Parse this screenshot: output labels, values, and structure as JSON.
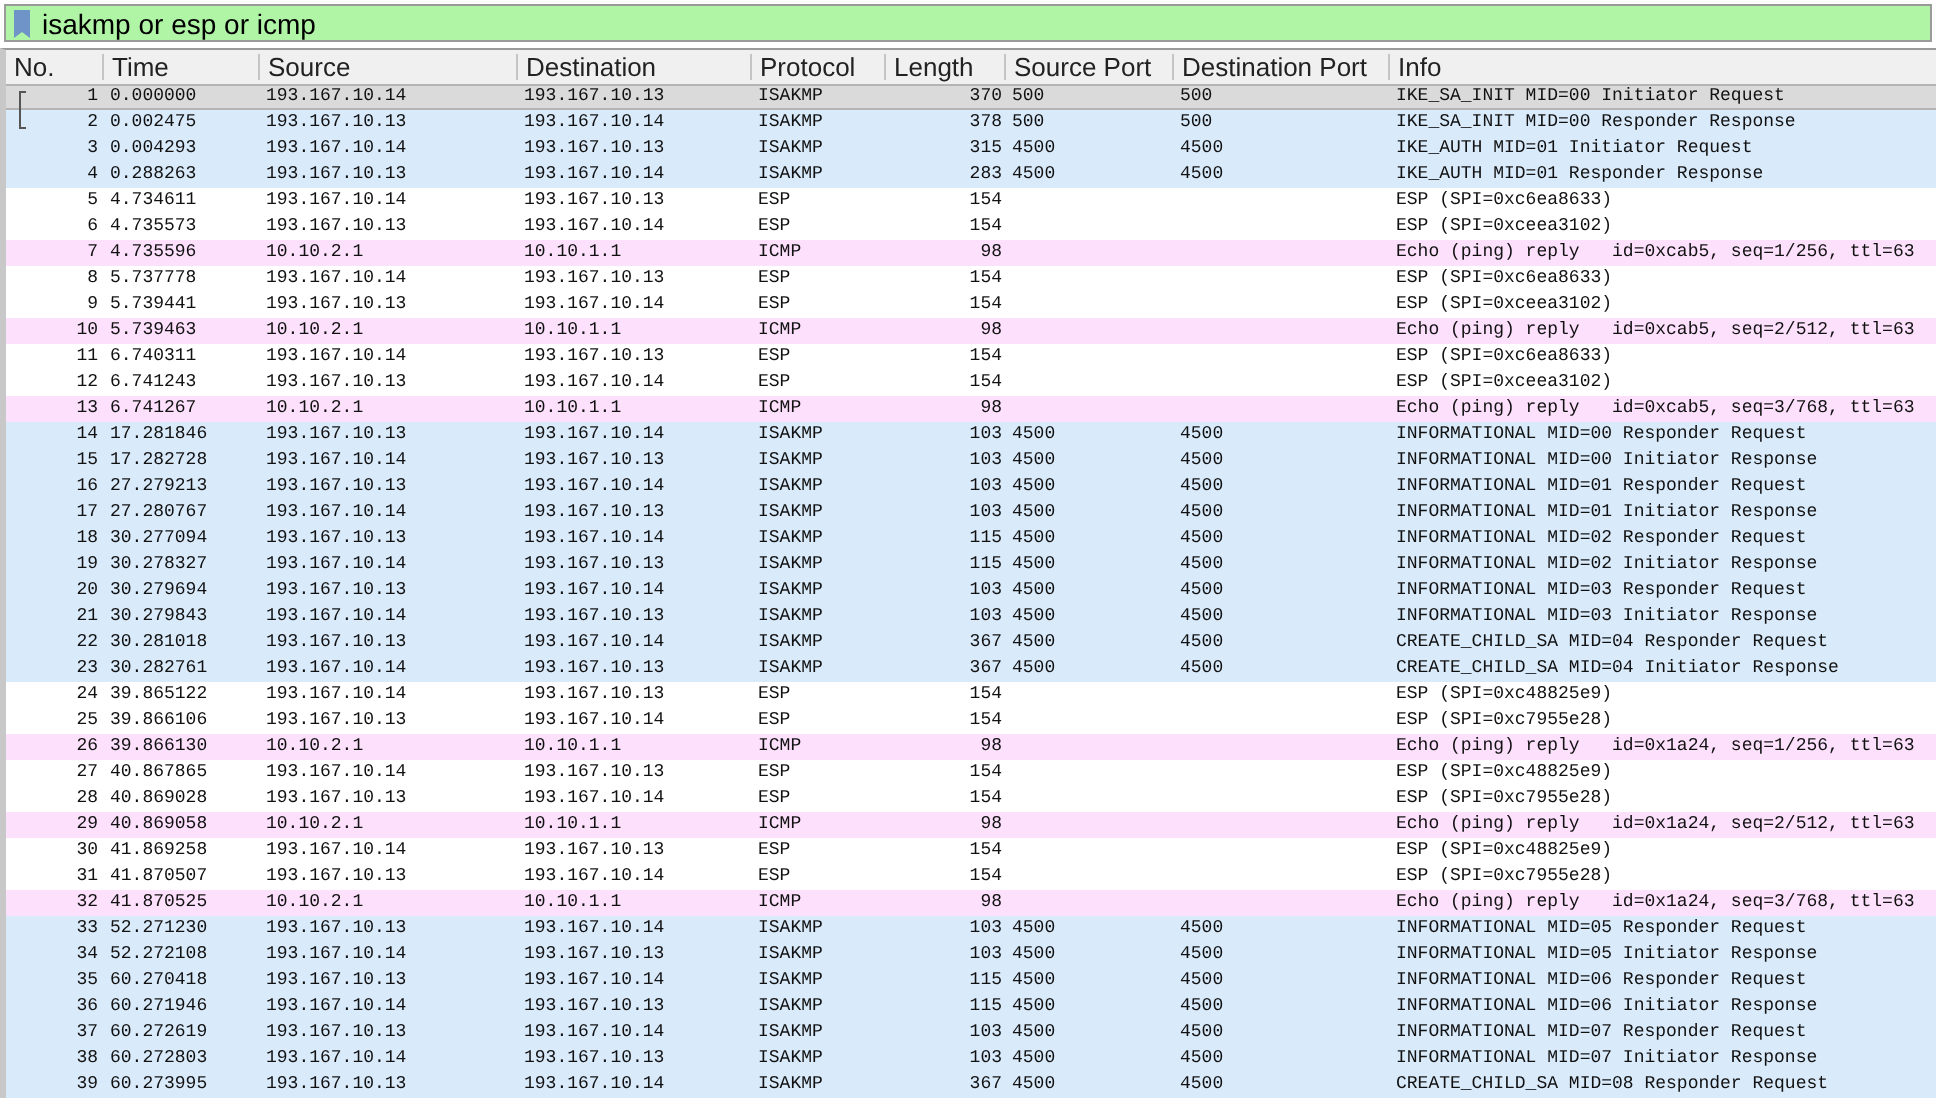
{
  "filter": {
    "value": "isakmp or esp or icmp"
  },
  "columns": [
    "No.",
    "Time",
    "Source",
    "Destination",
    "Protocol",
    "Length",
    "Source Port",
    "Destination Port",
    "Info"
  ],
  "rows": [
    {
      "no": "1",
      "time": "0.000000",
      "source": "193.167.10.14",
      "destination": "193.167.10.13",
      "protocol": "ISAKMP",
      "length": "370",
      "source_port": "500",
      "destination_port": "500",
      "info": "IKE_SA_INIT MID=00 Initiator Request",
      "color": "#dadada",
      "selected": true,
      "related": true
    },
    {
      "no": "2",
      "time": "0.002475",
      "source": "193.167.10.13",
      "destination": "193.167.10.14",
      "protocol": "ISAKMP",
      "length": "378",
      "source_port": "500",
      "destination_port": "500",
      "info": "IKE_SA_INIT MID=00 Responder Response",
      "color": "#d9eafb",
      "selected": false,
      "related": true
    },
    {
      "no": "3",
      "time": "0.004293",
      "source": "193.167.10.14",
      "destination": "193.167.10.13",
      "protocol": "ISAKMP",
      "length": "315",
      "source_port": "4500",
      "destination_port": "4500",
      "info": "IKE_AUTH MID=01 Initiator Request",
      "color": "#d9eafb",
      "selected": false,
      "related": false
    },
    {
      "no": "4",
      "time": "0.288263",
      "source": "193.167.10.13",
      "destination": "193.167.10.14",
      "protocol": "ISAKMP",
      "length": "283",
      "source_port": "4500",
      "destination_port": "4500",
      "info": "IKE_AUTH MID=01 Responder Response",
      "color": "#d9eafb",
      "selected": false,
      "related": false
    },
    {
      "no": "5",
      "time": "4.734611",
      "source": "193.167.10.14",
      "destination": "193.167.10.13",
      "protocol": "ESP",
      "length": "154",
      "info": "ESP (SPI=0xc6ea8633)",
      "color": "#ffffff",
      "selected": false,
      "related": false
    },
    {
      "no": "6",
      "time": "4.735573",
      "source": "193.167.10.13",
      "destination": "193.167.10.14",
      "protocol": "ESP",
      "length": "154",
      "info": "ESP (SPI=0xceea3102)",
      "color": "#ffffff",
      "selected": false,
      "related": false
    },
    {
      "no": "7",
      "time": "4.735596",
      "source": "10.10.2.1",
      "destination": "10.10.1.1",
      "protocol": "ICMP",
      "length": "98",
      "info": "Echo (ping) reply   id=0xcab5, seq=1/256, ttl=63",
      "color": "#fce0fc",
      "selected": false,
      "related": false
    },
    {
      "no": "8",
      "time": "5.737778",
      "source": "193.167.10.14",
      "destination": "193.167.10.13",
      "protocol": "ESP",
      "length": "154",
      "info": "ESP (SPI=0xc6ea8633)",
      "color": "#ffffff",
      "selected": false,
      "related": false
    },
    {
      "no": "9",
      "time": "5.739441",
      "source": "193.167.10.13",
      "destination": "193.167.10.14",
      "protocol": "ESP",
      "length": "154",
      "info": "ESP (SPI=0xceea3102)",
      "color": "#ffffff",
      "selected": false,
      "related": false
    },
    {
      "no": "10",
      "time": "5.739463",
      "source": "10.10.2.1",
      "destination": "10.10.1.1",
      "protocol": "ICMP",
      "length": "98",
      "info": "Echo (ping) reply   id=0xcab5, seq=2/512, ttl=63",
      "color": "#fce0fc",
      "selected": false,
      "related": false
    },
    {
      "no": "11",
      "time": "6.740311",
      "source": "193.167.10.14",
      "destination": "193.167.10.13",
      "protocol": "ESP",
      "length": "154",
      "info": "ESP (SPI=0xc6ea8633)",
      "color": "#ffffff",
      "selected": false,
      "related": false
    },
    {
      "no": "12",
      "time": "6.741243",
      "source": "193.167.10.13",
      "destination": "193.167.10.14",
      "protocol": "ESP",
      "length": "154",
      "info": "ESP (SPI=0xceea3102)",
      "color": "#ffffff",
      "selected": false,
      "related": false
    },
    {
      "no": "13",
      "time": "6.741267",
      "source": "10.10.2.1",
      "destination": "10.10.1.1",
      "protocol": "ICMP",
      "length": "98",
      "info": "Echo (ping) reply   id=0xcab5, seq=3/768, ttl=63",
      "color": "#fce0fc",
      "selected": false,
      "related": false
    },
    {
      "no": "14",
      "time": "17.281846",
      "source": "193.167.10.13",
      "destination": "193.167.10.14",
      "protocol": "ISAKMP",
      "length": "103",
      "source_port": "4500",
      "destination_port": "4500",
      "info": "INFORMATIONAL MID=00 Responder Request",
      "color": "#d9eafb",
      "selected": false,
      "related": false
    },
    {
      "no": "15",
      "time": "17.282728",
      "source": "193.167.10.14",
      "destination": "193.167.10.13",
      "protocol": "ISAKMP",
      "length": "103",
      "source_port": "4500",
      "destination_port": "4500",
      "info": "INFORMATIONAL MID=00 Initiator Response",
      "color": "#d9eafb",
      "selected": false,
      "related": false
    },
    {
      "no": "16",
      "time": "27.279213",
      "source": "193.167.10.13",
      "destination": "193.167.10.14",
      "protocol": "ISAKMP",
      "length": "103",
      "source_port": "4500",
      "destination_port": "4500",
      "info": "INFORMATIONAL MID=01 Responder Request",
      "color": "#d9eafb",
      "selected": false,
      "related": false
    },
    {
      "no": "17",
      "time": "27.280767",
      "source": "193.167.10.14",
      "destination": "193.167.10.13",
      "protocol": "ISAKMP",
      "length": "103",
      "source_port": "4500",
      "destination_port": "4500",
      "info": "INFORMATIONAL MID=01 Initiator Response",
      "color": "#d9eafb",
      "selected": false,
      "related": false
    },
    {
      "no": "18",
      "time": "30.277094",
      "source": "193.167.10.13",
      "destination": "193.167.10.14",
      "protocol": "ISAKMP",
      "length": "115",
      "source_port": "4500",
      "destination_port": "4500",
      "info": "INFORMATIONAL MID=02 Responder Request",
      "color": "#d9eafb",
      "selected": false,
      "related": false
    },
    {
      "no": "19",
      "time": "30.278327",
      "source": "193.167.10.14",
      "destination": "193.167.10.13",
      "protocol": "ISAKMP",
      "length": "115",
      "source_port": "4500",
      "destination_port": "4500",
      "info": "INFORMATIONAL MID=02 Initiator Response",
      "color": "#d9eafb",
      "selected": false,
      "related": false
    },
    {
      "no": "20",
      "time": "30.279694",
      "source": "193.167.10.13",
      "destination": "193.167.10.14",
      "protocol": "ISAKMP",
      "length": "103",
      "source_port": "4500",
      "destination_port": "4500",
      "info": "INFORMATIONAL MID=03 Responder Request",
      "color": "#d9eafb",
      "selected": false,
      "related": false
    },
    {
      "no": "21",
      "time": "30.279843",
      "source": "193.167.10.14",
      "destination": "193.167.10.13",
      "protocol": "ISAKMP",
      "length": "103",
      "source_port": "4500",
      "destination_port": "4500",
      "info": "INFORMATIONAL MID=03 Initiator Response",
      "color": "#d9eafb",
      "selected": false,
      "related": false
    },
    {
      "no": "22",
      "time": "30.281018",
      "source": "193.167.10.13",
      "destination": "193.167.10.14",
      "protocol": "ISAKMP",
      "length": "367",
      "source_port": "4500",
      "destination_port": "4500",
      "info": "CREATE_CHILD_SA MID=04 Responder Request",
      "color": "#d9eafb",
      "selected": false,
      "related": false
    },
    {
      "no": "23",
      "time": "30.282761",
      "source": "193.167.10.14",
      "destination": "193.167.10.13",
      "protocol": "ISAKMP",
      "length": "367",
      "source_port": "4500",
      "destination_port": "4500",
      "info": "CREATE_CHILD_SA MID=04 Initiator Response",
      "color": "#d9eafb",
      "selected": false,
      "related": false
    },
    {
      "no": "24",
      "time": "39.865122",
      "source": "193.167.10.14",
      "destination": "193.167.10.13",
      "protocol": "ESP",
      "length": "154",
      "info": "ESP (SPI=0xc48825e9)",
      "color": "#ffffff",
      "selected": false,
      "related": false
    },
    {
      "no": "25",
      "time": "39.866106",
      "source": "193.167.10.13",
      "destination": "193.167.10.14",
      "protocol": "ESP",
      "length": "154",
      "info": "ESP (SPI=0xc7955e28)",
      "color": "#ffffff",
      "selected": false,
      "related": false
    },
    {
      "no": "26",
      "time": "39.866130",
      "source": "10.10.2.1",
      "destination": "10.10.1.1",
      "protocol": "ICMP",
      "length": "98",
      "info": "Echo (ping) reply   id=0x1a24, seq=1/256, ttl=63",
      "color": "#fce0fc",
      "selected": false,
      "related": false
    },
    {
      "no": "27",
      "time": "40.867865",
      "source": "193.167.10.14",
      "destination": "193.167.10.13",
      "protocol": "ESP",
      "length": "154",
      "info": "ESP (SPI=0xc48825e9)",
      "color": "#ffffff",
      "selected": false,
      "related": false
    },
    {
      "no": "28",
      "time": "40.869028",
      "source": "193.167.10.13",
      "destination": "193.167.10.14",
      "protocol": "ESP",
      "length": "154",
      "info": "ESP (SPI=0xc7955e28)",
      "color": "#ffffff",
      "selected": false,
      "related": false
    },
    {
      "no": "29",
      "time": "40.869058",
      "source": "10.10.2.1",
      "destination": "10.10.1.1",
      "protocol": "ICMP",
      "length": "98",
      "info": "Echo (ping) reply   id=0x1a24, seq=2/512, ttl=63",
      "color": "#fce0fc",
      "selected": false,
      "related": false
    },
    {
      "no": "30",
      "time": "41.869258",
      "source": "193.167.10.14",
      "destination": "193.167.10.13",
      "protocol": "ESP",
      "length": "154",
      "info": "ESP (SPI=0xc48825e9)",
      "color": "#ffffff",
      "selected": false,
      "related": false
    },
    {
      "no": "31",
      "time": "41.870507",
      "source": "193.167.10.13",
      "destination": "193.167.10.14",
      "protocol": "ESP",
      "length": "154",
      "info": "ESP (SPI=0xc7955e28)",
      "color": "#ffffff",
      "selected": false,
      "related": false
    },
    {
      "no": "32",
      "time": "41.870525",
      "source": "10.10.2.1",
      "destination": "10.10.1.1",
      "protocol": "ICMP",
      "length": "98",
      "info": "Echo (ping) reply   id=0x1a24, seq=3/768, ttl=63",
      "color": "#fce0fc",
      "selected": false,
      "related": false
    },
    {
      "no": "33",
      "time": "52.271230",
      "source": "193.167.10.13",
      "destination": "193.167.10.14",
      "protocol": "ISAKMP",
      "length": "103",
      "source_port": "4500",
      "destination_port": "4500",
      "info": "INFORMATIONAL MID=05 Responder Request",
      "color": "#d9eafb",
      "selected": false,
      "related": false
    },
    {
      "no": "34",
      "time": "52.272108",
      "source": "193.167.10.14",
      "destination": "193.167.10.13",
      "protocol": "ISAKMP",
      "length": "103",
      "source_port": "4500",
      "destination_port": "4500",
      "info": "INFORMATIONAL MID=05 Initiator Response",
      "color": "#d9eafb",
      "selected": false,
      "related": false
    },
    {
      "no": "35",
      "time": "60.270418",
      "source": "193.167.10.13",
      "destination": "193.167.10.14",
      "protocol": "ISAKMP",
      "length": "115",
      "source_port": "4500",
      "destination_port": "4500",
      "info": "INFORMATIONAL MID=06 Responder Request",
      "color": "#d9eafb",
      "selected": false,
      "related": false
    },
    {
      "no": "36",
      "time": "60.271946",
      "source": "193.167.10.14",
      "destination": "193.167.10.13",
      "protocol": "ISAKMP",
      "length": "115",
      "source_port": "4500",
      "destination_port": "4500",
      "info": "INFORMATIONAL MID=06 Initiator Response",
      "color": "#d9eafb",
      "selected": false,
      "related": false
    },
    {
      "no": "37",
      "time": "60.272619",
      "source": "193.167.10.13",
      "destination": "193.167.10.14",
      "protocol": "ISAKMP",
      "length": "103",
      "source_port": "4500",
      "destination_port": "4500",
      "info": "INFORMATIONAL MID=07 Responder Request",
      "color": "#d9eafb",
      "selected": false,
      "related": false
    },
    {
      "no": "38",
      "time": "60.272803",
      "source": "193.167.10.14",
      "destination": "193.167.10.13",
      "protocol": "ISAKMP",
      "length": "103",
      "source_port": "4500",
      "destination_port": "4500",
      "info": "INFORMATIONAL MID=07 Initiator Response",
      "color": "#d9eafb",
      "selected": false,
      "related": false
    },
    {
      "no": "39",
      "time": "60.273995",
      "source": "193.167.10.13",
      "destination": "193.167.10.14",
      "protocol": "ISAKMP",
      "length": "367",
      "source_port": "4500",
      "destination_port": "4500",
      "info": "CREATE_CHILD_SA MID=08 Responder Request",
      "color": "#d9eafb",
      "selected": false,
      "related": false
    }
  ]
}
